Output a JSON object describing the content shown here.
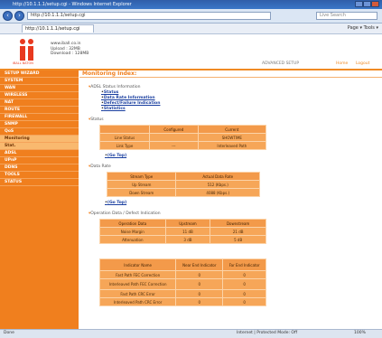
{
  "window": {
    "title": "http://10.1.1.1/setup.cgi - Windows Internet Explorer"
  },
  "address": {
    "url": "http://10.1.1.1/setup.cgi",
    "search_placeholder": "Live Search"
  },
  "tab": {
    "label": "http://10.1.1.1/setup.cgi",
    "tools": "Page ▾  Tools ▾"
  },
  "header": {
    "logo_text": "iBALL BATON",
    "info": [
      "www.iball.co.in",
      "Upload : 32MB",
      "Download : 128MB"
    ],
    "advanced_label": "ADVANCED SETUP",
    "home_label": "Home",
    "logout_label": "Logout"
  },
  "sidebar": {
    "items": [
      "SETUP WIZARD",
      "SYSTEM",
      "WAN",
      "WIRELESS",
      "NAT",
      "ROUTE",
      "FIREWALL",
      "SNMP",
      "QoS",
      "Monitoring",
      "Stat.",
      "ADSL",
      "UPnP",
      "DDNS",
      "TOOLS",
      "STATUS"
    ],
    "active_index": 9
  },
  "content": {
    "title": "Monitoring Index:",
    "adsl_section": {
      "label": "ADSL Status Information",
      "links": [
        "Status",
        "Data Rate Information",
        "Defect/Failure Indication",
        "Statistics"
      ]
    },
    "status_section": {
      "label": "Status",
      "headers": [
        "",
        "Configured",
        "Current"
      ],
      "rows": [
        [
          "Line Status",
          "",
          "SHOWTIME"
        ],
        [
          "Link Type",
          "---",
          "Interleaved Path"
        ]
      ],
      "top_link": "(Go Top)"
    },
    "datarate_section": {
      "label": "Data Rate",
      "headers": [
        "Stream Type",
        "Actual Data Rate"
      ],
      "rows": [
        [
          "Up Stream",
          "512 (Kbps.)"
        ],
        [
          "Down Stream",
          "4088 (Kbps.)"
        ]
      ],
      "top_link": "(Go Top)"
    },
    "operation_section": {
      "label": "Operation Data / Defect Indication",
      "headers": [
        "Operation Data",
        "Upstream",
        "Downstream"
      ],
      "rows": [
        [
          "Noise Margin",
          "11 dB",
          "21 dB"
        ],
        [
          "Attenuation",
          "3 dB",
          "5 dB"
        ]
      ]
    },
    "indicator_section": {
      "headers": [
        "Indicator Name",
        "Near End Indicator",
        "Far End Indicator"
      ],
      "rows": [
        [
          "Fast Path FEC Correction",
          "0",
          "0"
        ],
        [
          "Interleaved Path FEC Correction",
          "0",
          "0"
        ],
        [
          "Fast Path CRC Error",
          "0",
          "0"
        ],
        [
          "Interleaved Path CRC Error",
          "0",
          "0"
        ]
      ]
    }
  },
  "statusbar": {
    "left": "Done",
    "zone": "Internet | Protected Mode: Off",
    "zoom": "100%"
  }
}
